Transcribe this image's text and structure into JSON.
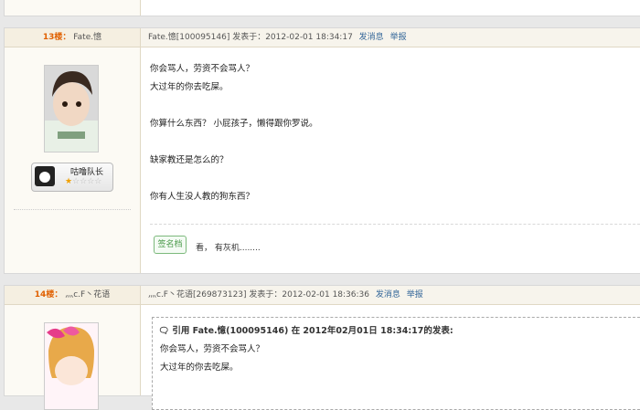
{
  "post13": {
    "floor": "13楼：",
    "user": "Fate.憶",
    "header_meta": "Fate.憶[100095146] 发表于：2012-02-01 18:34:17",
    "send_msg": "发消息",
    "report": "举报",
    "badge_title": "咕噜队长",
    "stars": "★☆☆☆☆",
    "lines": [
      "你会骂人，劳资不会骂人？",
      "大过年的你去吃屎。",
      "你算什么东西？ 小屁孩子，懒得跟你罗说。",
      "缺家教还是怎么的？",
      "你有人生没人教的狗东西？"
    ],
    "signature_label": "签名档",
    "signature_text": "看， 有灰机........"
  },
  "post14": {
    "floor": "14楼：",
    "user": "灬c.F丶花语",
    "header_meta": "灬c.F丶花语[269873123] 发表于：2012-02-01 18:36:36",
    "send_msg": "发消息",
    "report": "举报",
    "quote_head": "引用 Fate.憶(100095146) 在 2012年02月01日 18:34:17的发表:",
    "quote_lines": [
      "你会骂人，劳资不会骂人？",
      "大过年的你去吃屎。"
    ]
  }
}
